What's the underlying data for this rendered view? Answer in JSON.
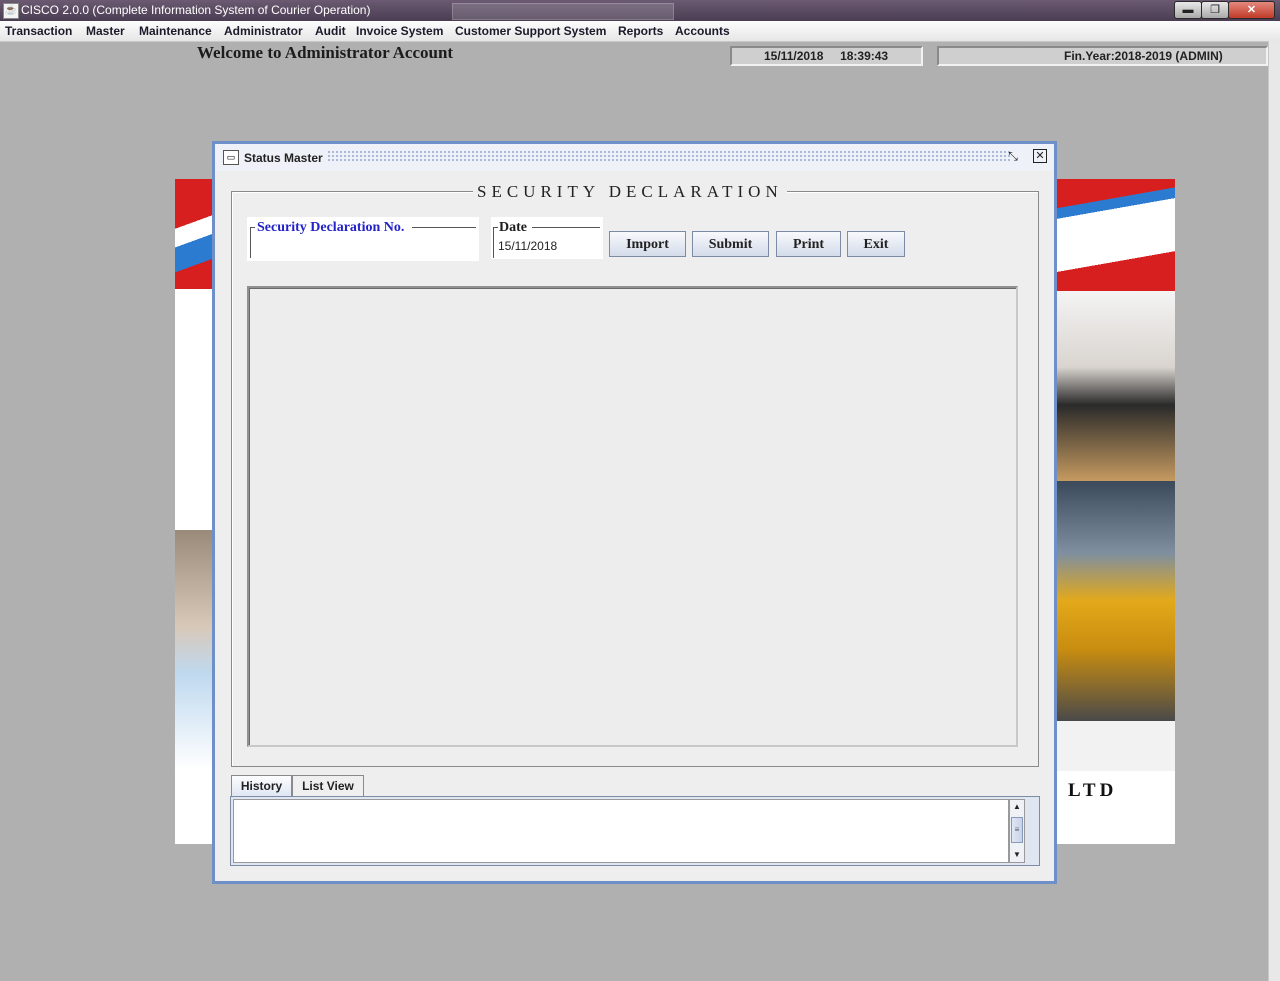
{
  "window": {
    "title": "CISCO 2.0.0 (Complete Information System of Courier Operation)",
    "icon": "java-cup-icon",
    "min_label": "▬",
    "max_label": "❐",
    "close_label": "✕"
  },
  "menu": {
    "items": [
      "Transaction",
      "Master",
      "Maintenance",
      "Administrator",
      "Audit",
      "Invoice System",
      "Customer Support System",
      "Reports",
      "Accounts"
    ]
  },
  "header": {
    "welcome": "Welcome to Administrator Account",
    "datetime": "15/11/2018     18:39:43",
    "finyear": "Fin.Year:2018-2019  (ADMIN)"
  },
  "background": {
    "brand_suffix": "LTD"
  },
  "dialog": {
    "title": "Status Master",
    "restore_label": "⤡",
    "close_label": "✕",
    "section_title": "SECURITY DECLARATION",
    "sec_no_label": "Security Declaration No.",
    "sec_no_value": "",
    "date_label": "Date",
    "date_value": "15/11/2018",
    "buttons": {
      "import": "Import",
      "submit": "Submit",
      "print": "Print",
      "exit": "Exit"
    },
    "tabs": [
      "History",
      "List View"
    ],
    "active_tab": "History",
    "history_text": "",
    "scroll": {
      "up": "▲",
      "thumb": "≡",
      "down": "▼"
    }
  },
  "colors": {
    "frame_border": "#6f8fc8",
    "label_blue": "#2323c8",
    "desktop_bg": "#b0b0b0"
  }
}
